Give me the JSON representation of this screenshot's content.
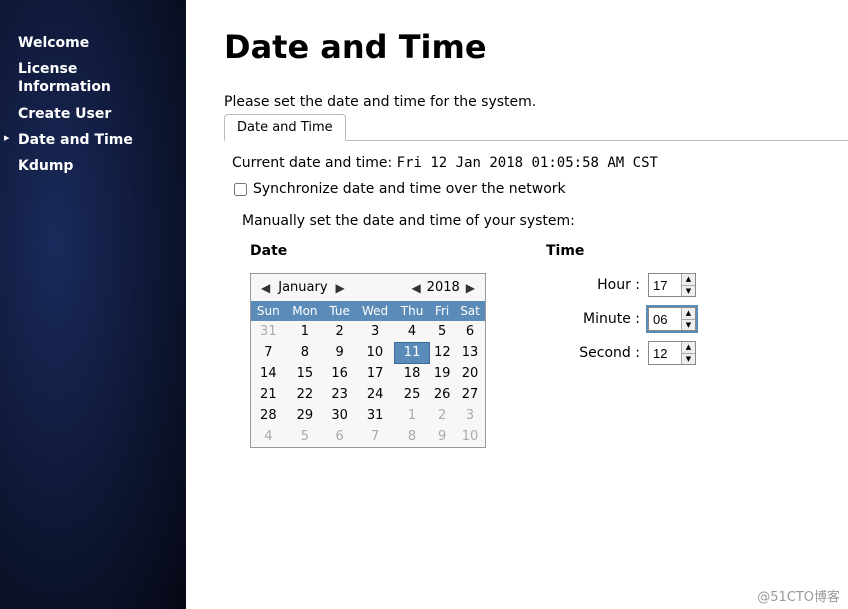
{
  "sidebar": {
    "items": [
      {
        "label": "Welcome"
      },
      {
        "label": "License Information"
      },
      {
        "label": "Create User"
      },
      {
        "label": "Date and Time"
      },
      {
        "label": "Kdump"
      }
    ],
    "active_index": 3
  },
  "page": {
    "title": "Date and Time",
    "intro": "Please set the date and time for the system."
  },
  "tab": {
    "label": "Date and Time"
  },
  "current": {
    "prefix": "Current date and time:",
    "value": "Fri 12 Jan 2018 01:05:58 AM CST"
  },
  "sync": {
    "checked": false,
    "label": "Synchronize date and time over the network"
  },
  "manual": {
    "label": "Manually set the date and time of your system:"
  },
  "date_section": {
    "heading": "Date",
    "month": "January",
    "year": "2018",
    "weekdays": [
      "Sun",
      "Mon",
      "Tue",
      "Wed",
      "Thu",
      "Fri",
      "Sat"
    ],
    "grid": [
      [
        {
          "d": 31,
          "dim": true
        },
        {
          "d": 1
        },
        {
          "d": 2
        },
        {
          "d": 3
        },
        {
          "d": 4
        },
        {
          "d": 5
        },
        {
          "d": 6
        }
      ],
      [
        {
          "d": 7
        },
        {
          "d": 8
        },
        {
          "d": 9
        },
        {
          "d": 10
        },
        {
          "d": 11,
          "sel": true
        },
        {
          "d": 12
        },
        {
          "d": 13
        }
      ],
      [
        {
          "d": 14
        },
        {
          "d": 15
        },
        {
          "d": 16
        },
        {
          "d": 17
        },
        {
          "d": 18
        },
        {
          "d": 19
        },
        {
          "d": 20
        }
      ],
      [
        {
          "d": 21
        },
        {
          "d": 22
        },
        {
          "d": 23
        },
        {
          "d": 24
        },
        {
          "d": 25
        },
        {
          "d": 26
        },
        {
          "d": 27
        }
      ],
      [
        {
          "d": 28
        },
        {
          "d": 29
        },
        {
          "d": 30
        },
        {
          "d": 31
        },
        {
          "d": 1,
          "dim": true
        },
        {
          "d": 2,
          "dim": true
        },
        {
          "d": 3,
          "dim": true
        }
      ],
      [
        {
          "d": 4,
          "dim": true
        },
        {
          "d": 5,
          "dim": true
        },
        {
          "d": 6,
          "dim": true
        },
        {
          "d": 7,
          "dim": true
        },
        {
          "d": 8,
          "dim": true
        },
        {
          "d": 9,
          "dim": true
        },
        {
          "d": 10,
          "dim": true
        }
      ]
    ]
  },
  "time_section": {
    "heading": "Time",
    "hour_label": "Hour :",
    "hour_value": "17",
    "minute_label": "Minute :",
    "minute_value": "06",
    "second_label": "Second :",
    "second_value": "12"
  },
  "watermark": "@51CTO博客"
}
